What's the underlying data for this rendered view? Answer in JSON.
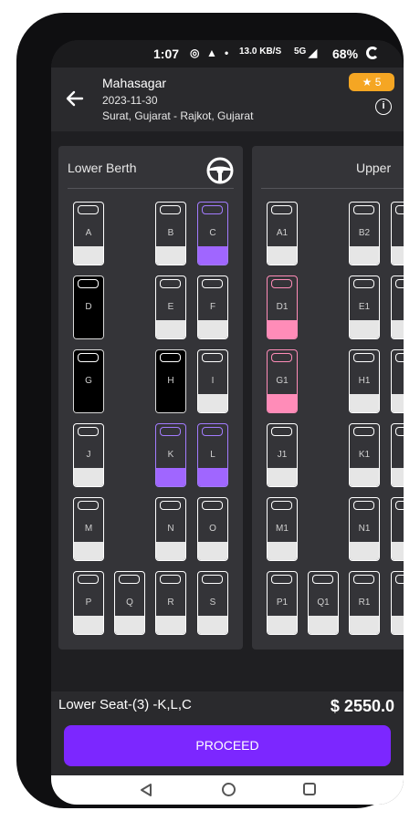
{
  "status_bar": {
    "time": "1:07",
    "network_speed": "13.0 KB/S",
    "signal": "5G",
    "battery": "68%"
  },
  "header": {
    "title": "Mahasagar",
    "date": "2023-11-30",
    "route": "Surat, Gujarat - Rajkot, Gujarat",
    "rating_star": "★",
    "rating_value": "5",
    "info_icon": "i"
  },
  "lower_deck": {
    "title": "Lower Berth",
    "seats": [
      {
        "label": "A",
        "state": "available"
      },
      {
        "label": "B",
        "state": "available"
      },
      {
        "label": "C",
        "state": "selected"
      },
      {
        "label": "D",
        "state": "booked"
      },
      {
        "label": "E",
        "state": "available"
      },
      {
        "label": "F",
        "state": "available"
      },
      {
        "label": "G",
        "state": "booked"
      },
      {
        "label": "H",
        "state": "booked"
      },
      {
        "label": "I",
        "state": "available"
      },
      {
        "label": "J",
        "state": "available"
      },
      {
        "label": "K",
        "state": "selected"
      },
      {
        "label": "L",
        "state": "selected"
      },
      {
        "label": "M",
        "state": "available"
      },
      {
        "label": "N",
        "state": "available"
      },
      {
        "label": "O",
        "state": "available"
      },
      {
        "label": "P",
        "state": "available"
      },
      {
        "label": "Q",
        "state": "available"
      },
      {
        "label": "R",
        "state": "available"
      },
      {
        "label": "S",
        "state": "available"
      }
    ]
  },
  "upper_deck": {
    "title": "Upper",
    "seats": [
      {
        "label": "A1",
        "state": "available"
      },
      {
        "label": "B2",
        "state": "available"
      },
      {
        "label": "D1",
        "state": "ladies"
      },
      {
        "label": "E1",
        "state": "available"
      },
      {
        "label": "G1",
        "state": "ladies"
      },
      {
        "label": "H1",
        "state": "available"
      },
      {
        "label": "J1",
        "state": "available"
      },
      {
        "label": "K1",
        "state": "available"
      },
      {
        "label": "M1",
        "state": "available"
      },
      {
        "label": "N1",
        "state": "available"
      },
      {
        "label": "P1",
        "state": "available"
      },
      {
        "label": "Q1",
        "state": "available"
      },
      {
        "label": "R1",
        "state": "available"
      }
    ]
  },
  "summary": {
    "selection_text": "Lower Seat-(3) -K,L,C",
    "price": "$ 2550.0"
  },
  "proceed_button": {
    "label": "PROCEED"
  },
  "colors": {
    "accent": "#7c27ff",
    "selected": "#a066ff",
    "ladies": "#ff8cb8",
    "rating": "#f5a623"
  }
}
